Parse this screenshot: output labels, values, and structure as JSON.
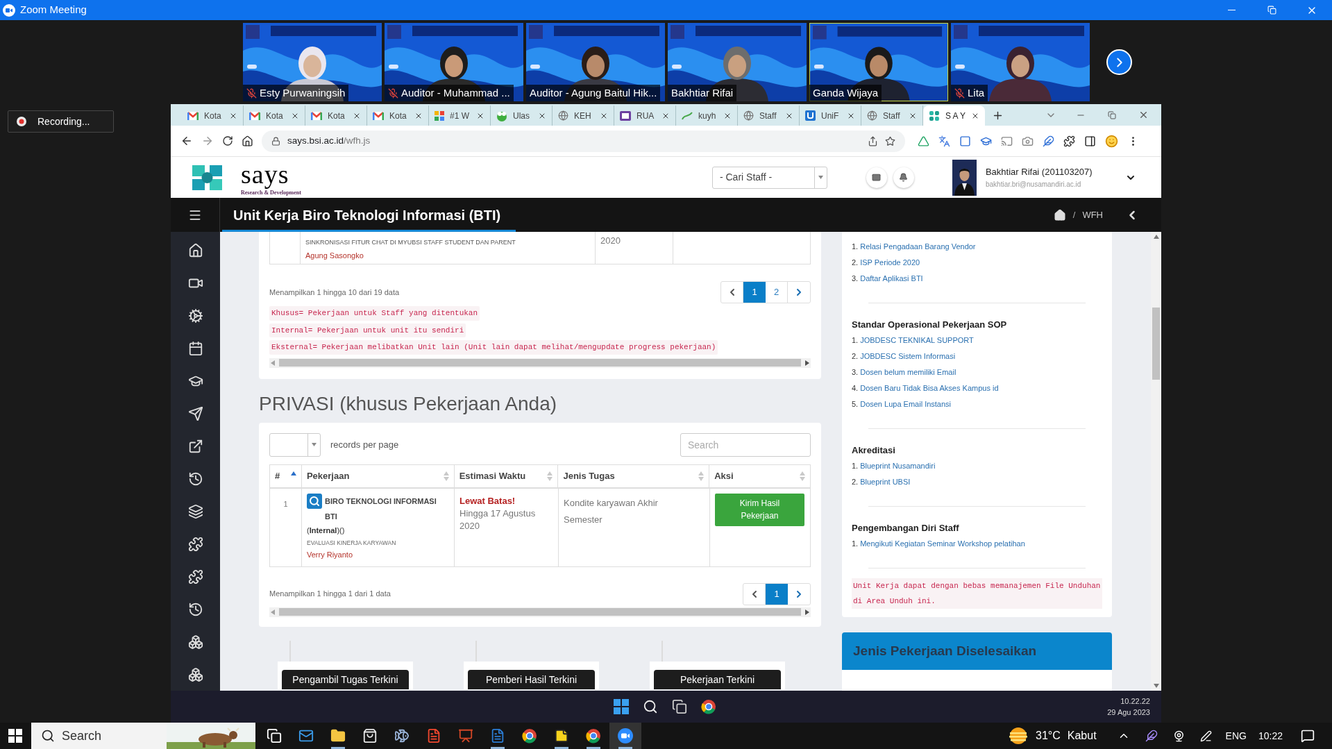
{
  "window": {
    "title": "Zoom Meeting"
  },
  "participants": [
    {
      "name": "Esty Purwaningsih",
      "muted": true,
      "speaking": false
    },
    {
      "name": "Auditor - Muhammad ...",
      "muted": true,
      "speaking": false
    },
    {
      "name": "Auditor - Agung Baitul Hik...",
      "muted": false,
      "speaking": false
    },
    {
      "name": "Bakhtiar Rifai",
      "muted": false,
      "speaking": false
    },
    {
      "name": "Ganda Wijaya",
      "muted": false,
      "speaking": true
    },
    {
      "name": "Lita",
      "muted": true,
      "speaking": false
    }
  ],
  "recording": {
    "label": "Recording..."
  },
  "browser": {
    "tabs": [
      {
        "label": "Kota",
        "kind": "mail",
        "selected": false
      },
      {
        "label": "Kota",
        "kind": "mail",
        "selected": false
      },
      {
        "label": "Kota",
        "kind": "mail",
        "selected": false
      },
      {
        "label": "Kota",
        "kind": "mail",
        "selected": false
      },
      {
        "label": "#1 W",
        "kind": "squares",
        "selected": false
      },
      {
        "label": "Ulas",
        "kind": "frog",
        "selected": false
      },
      {
        "label": "KEH",
        "kind": "globe",
        "selected": false
      },
      {
        "label": "RUA",
        "kind": "book",
        "selected": false
      },
      {
        "label": "kuyh",
        "kind": "leaf",
        "selected": false
      },
      {
        "label": "Staff",
        "kind": "globe",
        "selected": false
      },
      {
        "label": "UniF",
        "kind": "badge",
        "selected": false
      },
      {
        "label": "Staff",
        "kind": "globe",
        "selected": false
      },
      {
        "label": "S A Y",
        "kind": "flower",
        "selected": true
      }
    ],
    "url": {
      "host": "says.bsi.ac.id",
      "path": "/wfh.js"
    }
  },
  "site": {
    "logo": {
      "word": "says",
      "tagline": "Research & Development"
    },
    "staff_select": {
      "value": "- Cari Staff -"
    },
    "user": {
      "name": "Bakhtiar Rifai (201103207)",
      "email": "bakhtiar.bri@nusamandiri.ac.id"
    },
    "page_title": "Unit Kerja Biro Teknologi Informasi (BTI)",
    "breadcrumb": {
      "separator": "/",
      "current": "WFH"
    }
  },
  "task_table": {
    "partial_row": {
      "title": "SINKRONISASI FITUR CHAT DI MYUBSI STAFF STUDENT DAN PARENT",
      "person": "Agung Sasongko",
      "date": "2020"
    },
    "info": "Menampilkan 1 hingga 10 dari 19 data",
    "pages": [
      {
        "label": "1",
        "selected": true
      },
      {
        "label": "2",
        "selected": false
      }
    ],
    "notes": [
      "Khusus= Pekerjaan untuk Staff yang ditentukan",
      "Internal= Pekerjaan untuk unit itu sendiri",
      "Eksternal= Pekerjaan melibatkan Unit lain (Unit lain dapat melihat/mengupdate progress pekerjaan)"
    ]
  },
  "private_section": {
    "heading": "PRIVASI (khusus Pekerjaan Anda)",
    "length_label": "records per page",
    "search": {
      "placeholder": "Search"
    },
    "columns": [
      {
        "label": "#",
        "sorted": true
      },
      {
        "label": "Pekerjaan",
        "sorted": false
      },
      {
        "label": "Estimasi Waktu",
        "sorted": false
      },
      {
        "label": "Jenis Tugas",
        "sorted": false
      },
      {
        "label": "Aksi",
        "sorted": false
      }
    ],
    "rows": [
      {
        "number": "1",
        "unit": "BIRO TEKNOLOGI INFORMASI BTI",
        "type": "(**Internal**)()",
        "activity": "EVALUASI KINERJA KARYAWAN",
        "person": "Verry Riyanto",
        "deadline_status": "Lewat Batas!",
        "deadline": "Hingga 17 Agustus 2020",
        "task_type": "Kondite karyawan Akhir Semester",
        "action": "Kirim Hasil Pekerjaan"
      }
    ],
    "info": "Menampilkan 1 hingga 1 dari 1 data",
    "pages": [
      {
        "label": "1",
        "selected": true
      }
    ]
  },
  "recent_cards": [
    "Pengambil Tugas Terkini",
    "Pemberi Hasil Terkini",
    "Pekerjaan Terkini"
  ],
  "documents": {
    "groups": [
      {
        "items": [
          {
            "number": "1.",
            "label": "Relasi Pengadaan Barang Vendor"
          },
          {
            "number": "2.",
            "label": "ISP Periode 2020"
          },
          {
            "number": "3.",
            "label": "Daftar Aplikasi BTI"
          }
        ]
      },
      {
        "heading": "Standar Operasional Pekerjaan SOP",
        "items": [
          {
            "number": "1.",
            "label": "JOBDESC TEKNIKAL SUPPORT"
          },
          {
            "number": "2.",
            "label": "JOBDESC Sistem Informasi"
          },
          {
            "number": "3.",
            "label": "Dosen belum memiliki Email"
          },
          {
            "number": "4.",
            "label": "Dosen Baru Tidak Bisa Akses Kampus id"
          },
          {
            "number": "5.",
            "label": "Dosen Lupa Email Instansi"
          }
        ]
      },
      {
        "heading": "Akreditasi",
        "items": [
          {
            "number": "1.",
            "label": "Blueprint Nusamandiri"
          },
          {
            "number": "2.",
            "label": "Blueprint UBSI"
          }
        ]
      },
      {
        "heading": "Pengembangan Diri Staff",
        "items": [
          {
            "number": "1.",
            "label": "Mengikuti Kegiatan Seminar Workshop pelatihan"
          }
        ]
      }
    ],
    "note": "Unit Kerja dapat dengan bebas memanajemen File Unduhan di Area Unduh ini."
  },
  "completed_panel": {
    "title": "Jenis Pekerjaan Diselesaikan"
  },
  "remote_taskbar": {
    "time": "10.22.22",
    "date": "29 Agu 2023"
  },
  "taskbar": {
    "search": {
      "placeholder": "Search"
    },
    "apps": [
      {
        "kind": "taskview",
        "running": false,
        "selected": false
      },
      {
        "kind": "mail",
        "running": false,
        "selected": false
      },
      {
        "kind": "folder",
        "running": true,
        "selected": false
      },
      {
        "kind": "store",
        "running": false,
        "selected": false
      },
      {
        "kind": "fish",
        "running": false,
        "selected": false
      },
      {
        "kind": "pdf",
        "running": false,
        "selected": false
      },
      {
        "kind": "slides",
        "running": false,
        "selected": false
      },
      {
        "kind": "word",
        "running": true,
        "selected": false
      },
      {
        "kind": "browser",
        "running": false,
        "selected": false
      },
      {
        "kind": "notes",
        "running": true,
        "selected": false
      },
      {
        "kind": "browser",
        "running": true,
        "selected": false
      },
      {
        "kind": "zoom",
        "running": true,
        "selected": true
      }
    ],
    "weather": {
      "temperature": "31°C",
      "condition": "Kabut"
    },
    "language": "ENG",
    "time": "10:22"
  }
}
